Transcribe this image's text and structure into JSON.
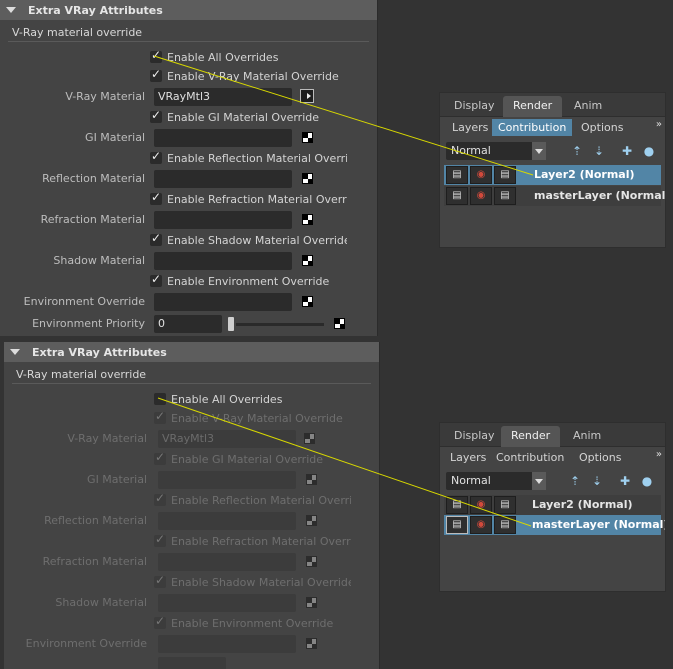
{
  "top_panel": {
    "section_title": "Extra VRay Attributes",
    "subsection_title": "V-Ray material override",
    "enable_all": {
      "label": "Enable All Overrides",
      "checked": true
    },
    "enable_vray": {
      "label": "Enable V-Ray Material Override",
      "checked": true
    },
    "vray_material": {
      "label": "V-Ray Material",
      "value": "VRayMtl3"
    },
    "enable_gi": {
      "label": "Enable GI Material Override",
      "checked": true
    },
    "gi_material": {
      "label": "GI Material",
      "value": ""
    },
    "enable_reflection": {
      "label": "Enable Reflection Material Override",
      "checked": true
    },
    "reflection_material": {
      "label": "Reflection Material",
      "value": ""
    },
    "enable_refraction": {
      "label": "Enable Refraction Material Override",
      "checked": true
    },
    "refraction_material": {
      "label": "Refraction Material",
      "value": ""
    },
    "enable_shadow": {
      "label": "Enable Shadow Material Override",
      "checked": true
    },
    "shadow_material": {
      "label": "Shadow Material",
      "value": ""
    },
    "enable_environment": {
      "label": "Enable Environment Override",
      "checked": true
    },
    "environment_override": {
      "label": "Environment Override",
      "value": ""
    },
    "environment_priority": {
      "label": "Environment Priority",
      "value": "0",
      "slider_level": 0
    }
  },
  "bottom_panel": {
    "section_title": "Extra VRay Attributes",
    "subsection_title": "V-Ray material override",
    "enable_all": {
      "label": "Enable All Overrides",
      "checked": false
    },
    "enable_vray": {
      "label": "Enable V-Ray Material Override",
      "checked": true
    },
    "vray_material": {
      "label": "V-Ray Material",
      "value": "VRayMtl3"
    },
    "enable_gi": {
      "label": "Enable GI Material Override",
      "checked": true
    },
    "gi_material": {
      "label": "GI Material",
      "value": ""
    },
    "enable_reflection": {
      "label": "Enable Reflection Material Override",
      "checked": true
    },
    "reflection_material": {
      "label": "Reflection Material",
      "value": ""
    },
    "enable_refraction": {
      "label": "Enable Refraction Material Override",
      "checked": true
    },
    "refraction_material": {
      "label": "Refraction Material",
      "value": ""
    },
    "enable_shadow": {
      "label": "Enable Shadow Material Override",
      "checked": true
    },
    "shadow_material": {
      "label": "Shadow Material",
      "value": ""
    },
    "enable_environment": {
      "label": "Enable Environment Override",
      "checked": true
    },
    "environment_override": {
      "label": "Environment Override",
      "value": ""
    }
  },
  "layer_editor_top": {
    "tabs": [
      "Display",
      "Render",
      "Anim"
    ],
    "active_tab": "Render",
    "menus": [
      "Layers",
      "Contribution",
      "Options"
    ],
    "highlighted_menu": "Contribution",
    "more": "»",
    "mode": "Normal",
    "layers": [
      {
        "name": "Layer2 (Normal)",
        "selected": true
      },
      {
        "name": "masterLayer (Normal)",
        "selected": false
      }
    ]
  },
  "layer_editor_bottom": {
    "tabs": [
      "Display",
      "Render",
      "Anim"
    ],
    "active_tab": "Render",
    "menus": [
      "Layers",
      "Contribution",
      "Options"
    ],
    "more": "»",
    "mode": "Normal",
    "layers": [
      {
        "name": "Layer2 (Normal)",
        "selected": false
      },
      {
        "name": "masterLayer (Normal)",
        "selected": true
      }
    ]
  },
  "icons": {
    "collapse": "triangle-down-icon",
    "checkbox": "check-icon",
    "map_button": "map-button-icon",
    "texture": "checker-icon",
    "clapper": "clapperboard-icon",
    "eye": "eye-icon"
  },
  "colors": {
    "panel_bg": "#444444",
    "header_bg": "#5d5d5d",
    "field_bg": "#2b2b2b",
    "selection": "#5285a6",
    "annotation_line": "#d8d800"
  }
}
